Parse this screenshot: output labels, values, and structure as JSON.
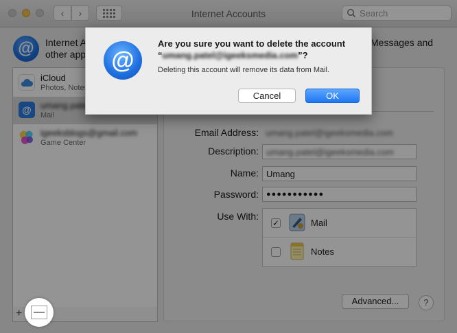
{
  "window": {
    "title": "Internet Accounts",
    "search_placeholder": "Search"
  },
  "header": {
    "text_left_line1": "Internet A",
    "text_left_line2": "other app",
    "text_right_line1": "Messages and"
  },
  "sidebar": {
    "accounts": [
      {
        "name": "iCloud",
        "subtitle": "Photos, Notes",
        "icon": "icloud-icon"
      },
      {
        "name": "umang.patel",
        "subtitle": "Mail",
        "icon": "mail-at-icon"
      },
      {
        "name": "igeeksblogs@gmail.com",
        "subtitle": "Game Center",
        "icon": "game-center-icon"
      }
    ],
    "add_label": "+",
    "remove_label": "—"
  },
  "detail": {
    "email_label": "Email Address:",
    "email_value": "umang.patel@igeeksmedia.com",
    "description_label": "Description:",
    "description_value": "umang.patel@igeeksmedia.com",
    "name_label": "Name:",
    "name_value": "Umang",
    "password_label": "Password:",
    "password_value": "●●●●●●●●●●●",
    "use_with_label": "Use With:",
    "apps": [
      {
        "label": "Mail",
        "checked": true,
        "check_glyph": "✓",
        "icon": "mail-app-icon"
      },
      {
        "label": "Notes",
        "checked": false,
        "check_glyph": "",
        "icon": "notes-app-icon"
      }
    ],
    "advanced_label": "Advanced...",
    "help_label": "?"
  },
  "dialog": {
    "title_line1": "Are you sure you want to delete the account",
    "title_quote_open": "“",
    "title_email": "umang.patel@igeeksmedia.com",
    "title_quote_close": "”?",
    "message": "Deleting this account will remove its data from Mail.",
    "cancel_label": "Cancel",
    "ok_label": "OK"
  },
  "colors": {
    "accent": "#1f76f3",
    "selected_row": "#d9d9d9"
  }
}
